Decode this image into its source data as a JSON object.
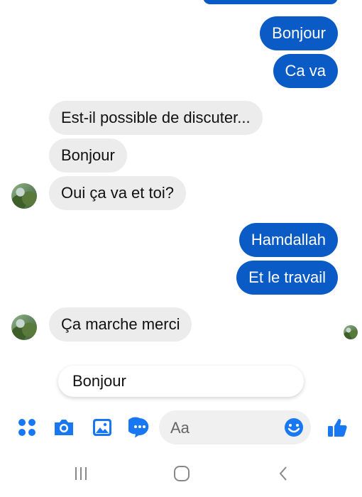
{
  "messages": [
    {
      "text": "Bonjour"
    },
    {
      "text": "Ca va"
    },
    {
      "text": "Est-il possible de discuter..."
    },
    {
      "text": "Bonjour"
    },
    {
      "text": "Oui ça va et toi?"
    },
    {
      "text": "Hamdallah"
    },
    {
      "text": "Et le travail"
    },
    {
      "text": "Ça marche merci"
    }
  ],
  "suggestion": {
    "text": "Bonjour"
  },
  "composer": {
    "placeholder": "Aa"
  },
  "colors": {
    "accent": "#0b5bc7",
    "incoming": "#ececec",
    "icon": "#1877f2"
  },
  "icons": [
    "apps-icon",
    "camera-icon",
    "image-icon",
    "chat-icon",
    "emoji-icon",
    "thumbs-up-icon",
    "recent-apps-icon",
    "home-icon",
    "back-icon"
  ]
}
